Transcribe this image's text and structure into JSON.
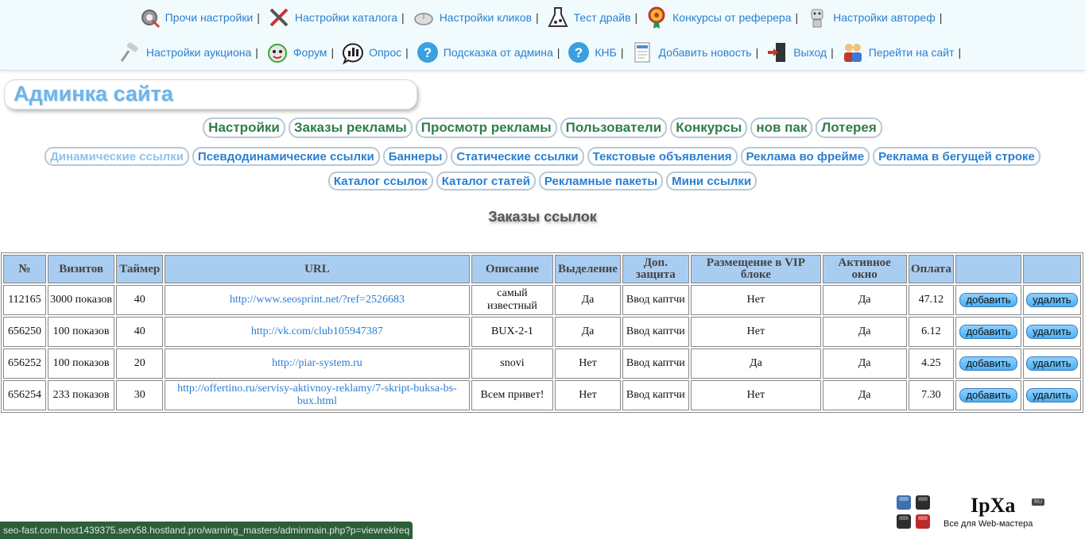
{
  "topmenu": {
    "row1": [
      {
        "label": "Прочи настройки",
        "icon": "gear-icon"
      },
      {
        "label": "Настройки каталога",
        "icon": "tools-icon"
      },
      {
        "label": "Настройки кликов",
        "icon": "mouse-icon"
      },
      {
        "label": "Тест драйв",
        "icon": "flask-icon"
      },
      {
        "label": "Конкурсы от реферера",
        "icon": "medal-icon"
      },
      {
        "label": "Настройки автореф",
        "icon": "robot-icon"
      }
    ],
    "row2": [
      {
        "label": "Настройки аукциона",
        "icon": "gavel-icon"
      },
      {
        "label": "Форум",
        "icon": "forum-cat-icon"
      },
      {
        "label": "Опрос",
        "icon": "poll-icon"
      },
      {
        "label": "Подсказка от админа",
        "icon": "help-icon"
      },
      {
        "label": "КНБ",
        "icon": "help-icon"
      },
      {
        "label": "Добавить новость",
        "icon": "news-icon"
      },
      {
        "label": "Выход",
        "icon": "exit-icon"
      },
      {
        "label": "Перейти на сайт",
        "icon": "people-icon"
      }
    ],
    "separator": "|"
  },
  "title": "Админка сайта",
  "main_nav": [
    "Настройки",
    "Заказы рекламы",
    "Просмотр рекламы",
    "Пользователи",
    "Конкурсы",
    "нов пак",
    "Лотерея"
  ],
  "sub_nav_row1": [
    "Динамические ссылки",
    "Псевдодинамические ссылки",
    "Баннеры",
    "Статические ссылки",
    "Текстовые объявления",
    "Реклама во фрейме",
    "Реклама в бегущей строке"
  ],
  "sub_nav_row2": [
    "Каталог ссылок",
    "Каталог статей",
    "Рекламные пакеты",
    "Мини ссылки"
  ],
  "active_sub": "Динамические ссылки",
  "section_title": "Заказы ссылок",
  "table": {
    "headers": [
      "№",
      "Визитов",
      "Таймер",
      "URL",
      "Описание",
      "Выделение",
      "Доп. защита",
      "Размещение в VIP блоке",
      "Активное окно",
      "Оплата",
      "",
      ""
    ],
    "add_label": "добавить",
    "delete_label": "удалить",
    "rows": [
      [
        "112165",
        "3000 показов",
        "40",
        "http://www.seosprint.net/?ref=2526683",
        "самый известный",
        "Да",
        "Ввод каптчи",
        "Нет",
        "Да",
        "47.12"
      ],
      [
        "656250",
        "100 показов",
        "40",
        "http://vk.com/club105947387",
        "BUX-2-1",
        "Да",
        "Ввод каптчи",
        "Нет",
        "Да",
        "6.12"
      ],
      [
        "656252",
        "100 показов",
        "20",
        "http://piar-system.ru",
        "snovi",
        "Нет",
        "Ввод каптчи",
        "Да",
        "Да",
        "4.25"
      ],
      [
        "656254",
        "233 показов",
        "30",
        "http://offertino.ru/servisy-aktivnoy-reklamy/7-skript-buksa-bs-bux.html",
        "Всем привет!",
        "Нет",
        "Ввод каптчи",
        "Нет",
        "Да",
        "7.30"
      ]
    ]
  },
  "status_bar": "seo-fast.com.host1439375.serv58.hostland.pro/warning_masters/adminmain.php?p=viewreklreq",
  "logo": {
    "name": "IpXa",
    "ru": "RU",
    "tagline": "Все для Web-мастера"
  }
}
